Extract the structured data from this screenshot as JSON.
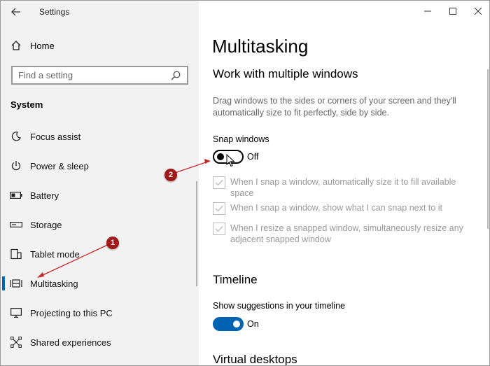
{
  "window": {
    "title": "Settings"
  },
  "sidebar": {
    "home_label": "Home",
    "search_placeholder": "Find a setting",
    "section": "System",
    "items": [
      {
        "label": "Focus assist",
        "icon": "moon-icon"
      },
      {
        "label": "Power & sleep",
        "icon": "power-icon"
      },
      {
        "label": "Battery",
        "icon": "battery-icon"
      },
      {
        "label": "Storage",
        "icon": "storage-icon"
      },
      {
        "label": "Tablet mode",
        "icon": "tablet-mode-icon"
      },
      {
        "label": "Multitasking",
        "icon": "multitasking-icon",
        "active": true
      },
      {
        "label": "Projecting to this PC",
        "icon": "projecting-icon"
      },
      {
        "label": "Shared experiences",
        "icon": "shared-experiences-icon"
      }
    ]
  },
  "main": {
    "title": "Multitasking",
    "section1": {
      "heading": "Work with multiple windows",
      "description": "Drag windows to the sides or corners of your screen and they'll automatically size to fit perfectly, side by side.",
      "snap_label": "Snap windows",
      "snap_state": "Off",
      "snap_on": false,
      "options": [
        "When I snap a window, automatically size it to fill available space",
        "When I snap a window, show what I can snap next to it",
        "When I resize a snapped window, simultaneously resize any adjacent snapped window"
      ]
    },
    "section2": {
      "heading": "Timeline",
      "suggest_label": "Show suggestions in your timeline",
      "suggest_state": "On",
      "suggest_on": true
    },
    "section3": {
      "heading": "Virtual desktops"
    }
  },
  "annotations": {
    "badge1": "1",
    "badge2": "2",
    "color": "#a01a1a"
  },
  "colors": {
    "accent": "#0063b1",
    "sidebar_bg": "#f2f2f2"
  }
}
